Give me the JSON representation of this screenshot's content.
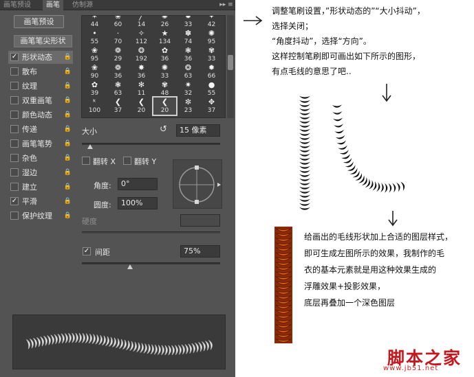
{
  "tabs": [
    {
      "label": "画笔预设",
      "active": false
    },
    {
      "label": "画笔",
      "active": true
    },
    {
      "label": "仿制源",
      "active": false
    }
  ],
  "tab_menu_icon": "double-chevron-menu-icon",
  "presets_button": "画笔预设",
  "tip_shape_label": "画笔笔尖形状",
  "options": [
    {
      "label": "形状动态",
      "checked": true,
      "selected": true
    },
    {
      "label": "散布",
      "checked": false
    },
    {
      "label": "纹理",
      "checked": false
    },
    {
      "label": "双重画笔",
      "checked": false
    },
    {
      "label": "颜色动态",
      "checked": false
    },
    {
      "label": "传递",
      "checked": false
    },
    {
      "label": "画笔笔势",
      "checked": false
    },
    {
      "label": "杂色",
      "checked": false
    },
    {
      "label": "湿边",
      "checked": false
    },
    {
      "label": "建立",
      "checked": false
    },
    {
      "label": "平滑",
      "checked": true
    },
    {
      "label": "保护纹理",
      "checked": false
    }
  ],
  "brush_tips": [
    [
      "44",
      "60",
      "14",
      "26",
      "33",
      "42"
    ],
    [
      "55",
      "70",
      "112",
      "134",
      "74",
      "95"
    ],
    [
      "95",
      "29",
      "192",
      "36",
      "36",
      "33"
    ],
    [
      "90",
      "36",
      "36",
      "33",
      "63",
      "66"
    ],
    [
      "39",
      "63",
      "11",
      "48",
      "32",
      "55"
    ],
    [
      "100",
      "37",
      "20",
      "20",
      "23",
      "37"
    ]
  ],
  "brush_tip_glyphs": [
    [
      "✶",
      "❀",
      "╱",
      "✺",
      "✹",
      "✦"
    ],
    [
      "•",
      "·",
      "✧",
      "★",
      "✽",
      "✺"
    ],
    [
      "❀",
      "❁",
      "❂",
      "✿",
      "❃",
      "✾"
    ],
    [
      "❀",
      "❁",
      "✸",
      "✺",
      "❂",
      "✹"
    ],
    [
      "✿",
      "❃",
      "✻",
      "✾",
      "✷",
      "●"
    ],
    [
      "ᵏ",
      "❮",
      "❮",
      "❮",
      "✼",
      "✥"
    ]
  ],
  "active_tip": [
    5,
    3
  ],
  "size": {
    "label": "大小",
    "value": "15 像素",
    "slider": 0.06
  },
  "flip_x": {
    "label": "翻转 X",
    "checked": false
  },
  "flip_y": {
    "label": "翻转 Y",
    "checked": false
  },
  "angle": {
    "label": "角度:",
    "value": "0°"
  },
  "roundness": {
    "label": "圆度:",
    "value": "100%"
  },
  "hardness": {
    "label": "硬度",
    "value": ""
  },
  "spacing": {
    "label": "间距",
    "checked": true,
    "value": "75%",
    "slider": 0.35
  },
  "notes": {
    "lines_top": [
      "调整笔刷设置，”形状动态的”“大小抖动”，",
      "选择关闭；",
      "“角度抖动”，选择“方向”。",
      "这样控制笔刷即可画出如下所示的图形，",
      "有点毛线的意思了吧.."
    ],
    "lines_bottom": [
      "给画出的毛线形状加上合适的图层样式，",
      "即可生成左图所示的效果，我制作的毛",
      "衣的基本元素就是用这种效果生成的",
      "浮雕效果+投影效果，",
      "底层再叠加一个深色图层"
    ]
  },
  "watermark": {
    "cn": "脚本之家",
    "url": "www.jb51.net"
  },
  "colors": {
    "panel_bg": "#535353",
    "rope_orange": "#e8640c",
    "rope_dark": "#8a2a05",
    "watermark": "#c8161d"
  }
}
